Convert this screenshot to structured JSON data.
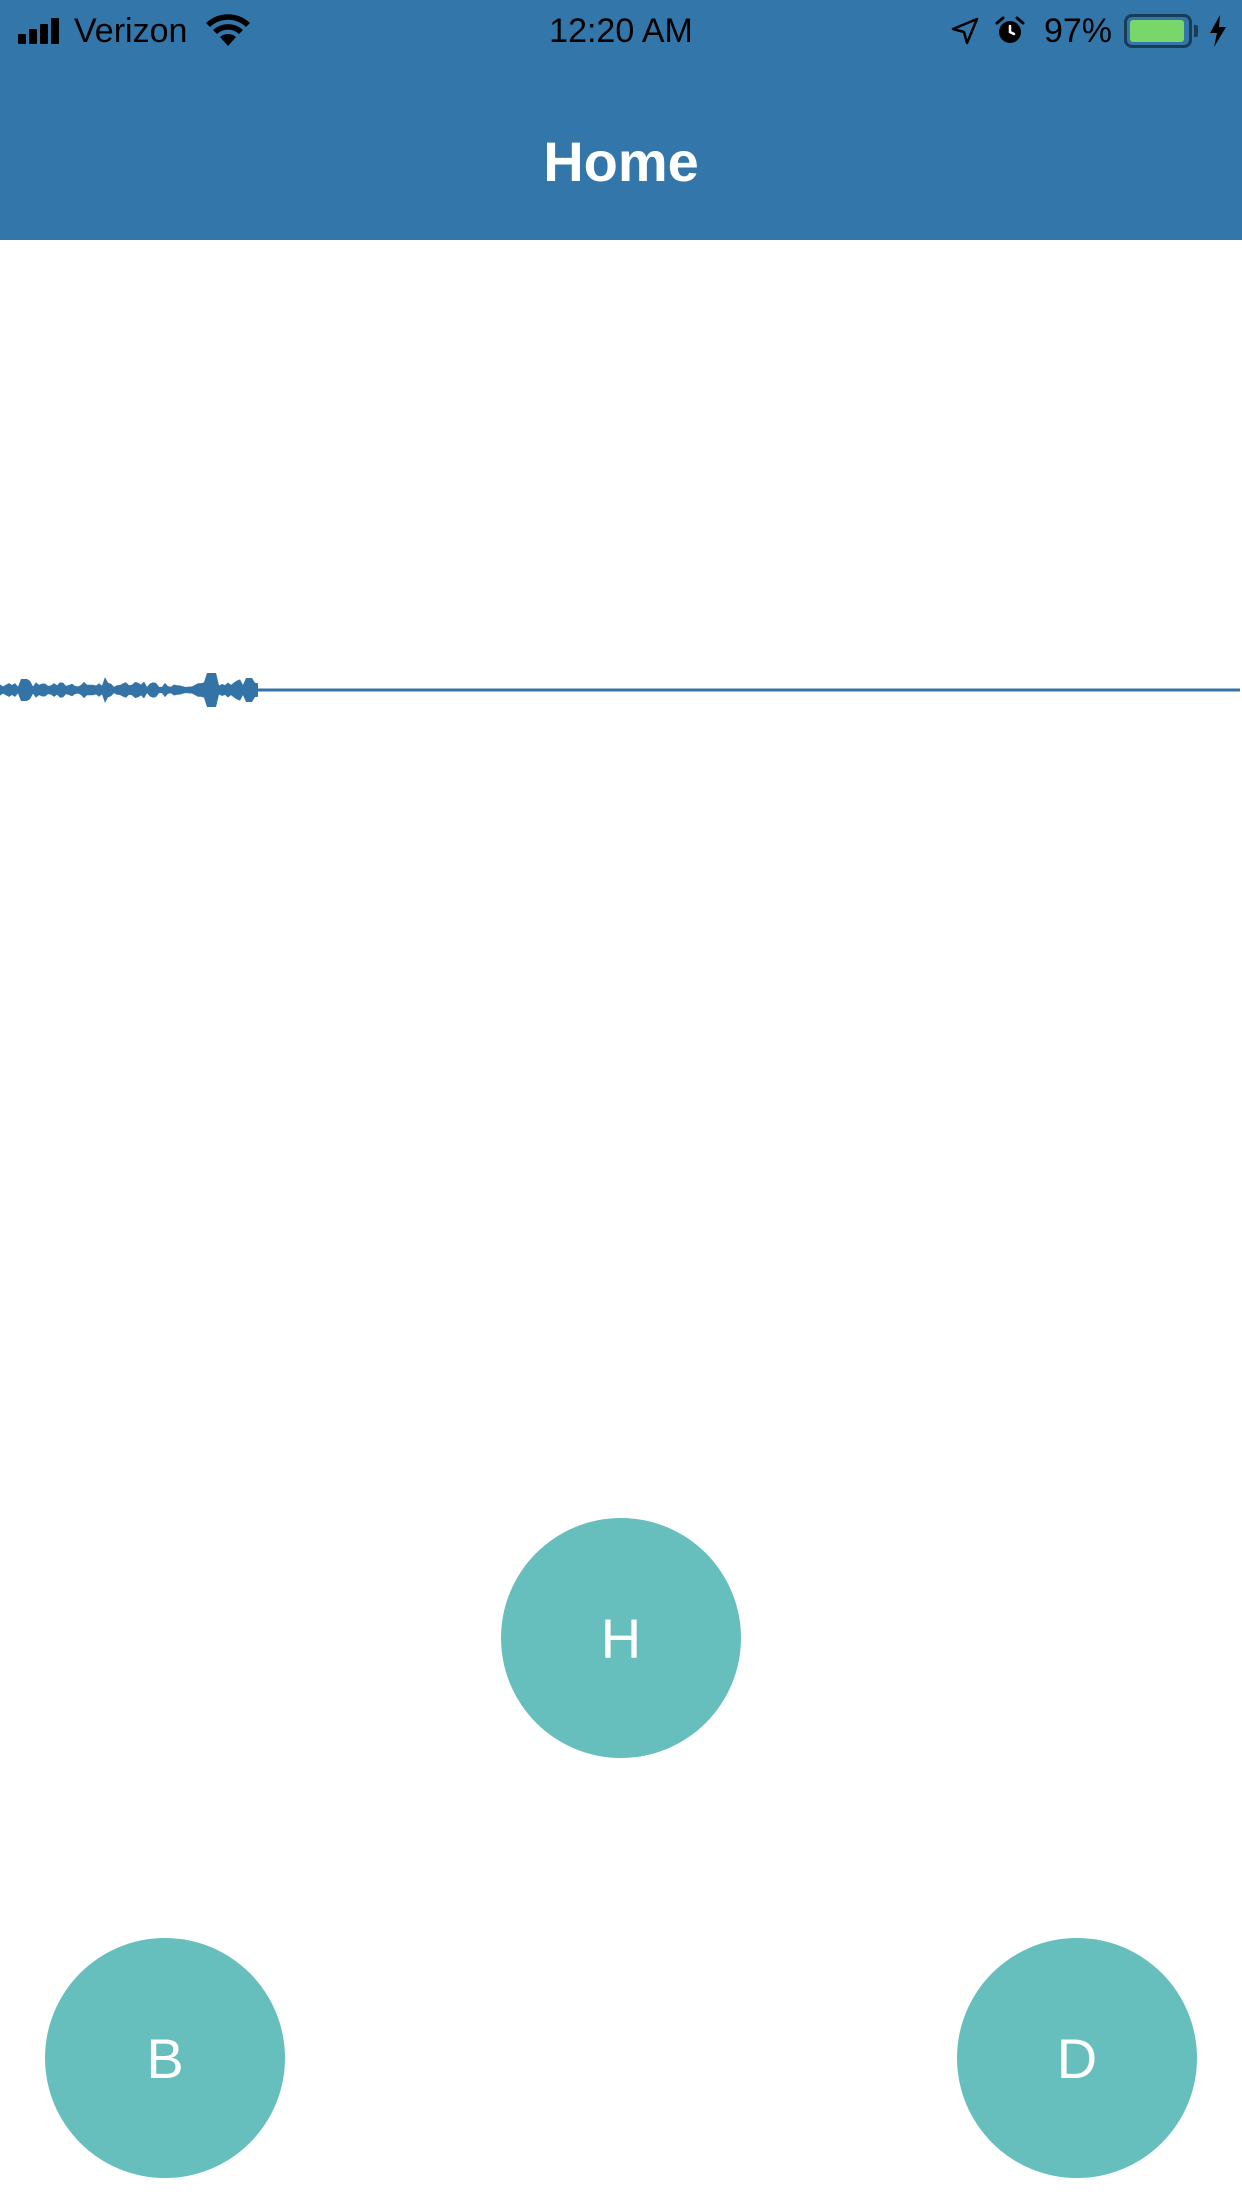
{
  "status_bar": {
    "carrier": "Verizon",
    "time": "12:20 AM",
    "battery_percent": "97%",
    "battery_level": 0.97,
    "icons": [
      "signal-icon",
      "wifi-icon",
      "location-arrow-icon",
      "alarm-icon",
      "battery-icon",
      "charging-bolt-icon"
    ]
  },
  "header": {
    "title": "Home",
    "background_color": "#3377aa"
  },
  "waveform": {
    "color": "#3373a6",
    "recorded_fraction": 0.21
  },
  "buttons": {
    "h_label": "H",
    "b_label": "B",
    "d_label": "D",
    "color": "#66bfbd"
  }
}
